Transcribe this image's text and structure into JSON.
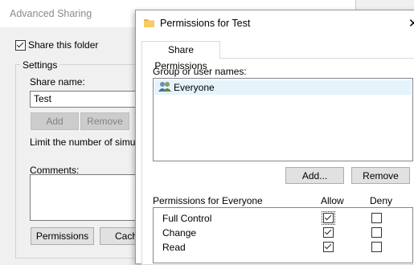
{
  "advanced_sharing": {
    "title": "Advanced Sharing",
    "share_checkbox_label": "Share this folder",
    "share_checked": true,
    "settings_legend": "Settings",
    "share_name_label": "Share name:",
    "share_name_value": "Test",
    "add_label": "Add",
    "remove_label": "Remove",
    "limit_text": "Limit the number of simultan",
    "comments_label": "Comments:",
    "permissions_button": "Permissions",
    "caching_button": "Cach"
  },
  "permissions": {
    "title": "Permissions for Test",
    "tab_label": "Share Permissions",
    "group_label": "Group or user names:",
    "users": [
      "Everyone"
    ],
    "add_button": "Add...",
    "remove_button": "Remove",
    "perm_header": "Permissions for Everyone",
    "allow_header": "Allow",
    "deny_header": "Deny",
    "rows": [
      {
        "name": "Full Control",
        "allow": true,
        "deny": false
      },
      {
        "name": "Change",
        "allow": true,
        "deny": false
      },
      {
        "name": "Read",
        "allow": true,
        "deny": false
      }
    ]
  }
}
